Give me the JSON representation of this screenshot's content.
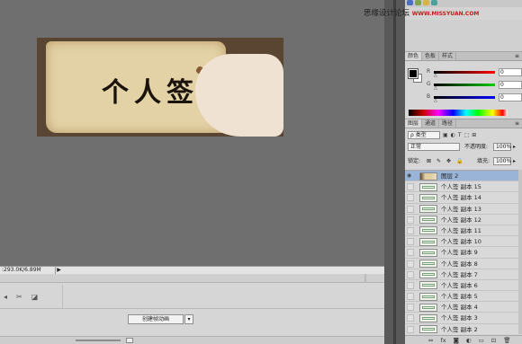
{
  "canvas": {
    "title_art": "个人签"
  },
  "status": {
    "doc_size": ":293.0K/6.89M",
    "arrow": "▶"
  },
  "timeline": {
    "create_button": "创建帧动画",
    "dropdown_arrow": "▾",
    "tools": [
      "◂",
      "✂",
      "◪"
    ]
  },
  "watermark": {
    "cn": "思缘设计论坛",
    "en": "WWW.MISSYUAN.COM"
  },
  "color_panel": {
    "tabs": [
      "颜色",
      "色板",
      "样式"
    ],
    "active_tab": 0,
    "menu": "≡",
    "channels": [
      {
        "label": "R",
        "value": "0",
        "color": "#cc0000"
      },
      {
        "label": "G",
        "value": "0",
        "color": "#009900"
      },
      {
        "label": "B",
        "value": "0",
        "color": "#0000cc"
      }
    ],
    "foreground": "#000000",
    "background": "#ffffff"
  },
  "layers_panel": {
    "tabs": [
      "图层",
      "通道",
      "路径"
    ],
    "active_tab": 0,
    "menu": "≡",
    "filter_select": "ρ 类型",
    "filter_icons": [
      "▣",
      "◐",
      "T",
      "⬚",
      "⊞"
    ],
    "blend_mode": "正常",
    "opacity_label": "不透明度:",
    "opacity_value": "100%",
    "lock_label": "锁定:",
    "lock_icons": [
      "⊠",
      "✎",
      "✥",
      "🔒"
    ],
    "fill_label": "填充:",
    "fill_value": "100%",
    "layers": [
      {
        "name": "图层 2",
        "visible": true,
        "selected": true,
        "photo": true
      },
      {
        "name": "个人签 副本 15",
        "visible": false
      },
      {
        "name": "个人签 副本 14",
        "visible": false
      },
      {
        "name": "个人签 副本 13",
        "visible": false
      },
      {
        "name": "个人签 副本 12",
        "visible": false
      },
      {
        "name": "个人签 副本 11",
        "visible": false
      },
      {
        "name": "个人签 副本 10",
        "visible": false
      },
      {
        "name": "个人签 副本 9",
        "visible": false
      },
      {
        "name": "个人签 副本 8",
        "visible": false
      },
      {
        "name": "个人签 副本 7",
        "visible": false
      },
      {
        "name": "个人签 副本 6",
        "visible": false
      },
      {
        "name": "个人签 副本 5",
        "visible": false
      },
      {
        "name": "个人签 副本 4",
        "visible": false
      },
      {
        "name": "个人签 副本 3",
        "visible": false
      },
      {
        "name": "个人签 副本 2",
        "visible": false
      }
    ],
    "footer_icons": [
      "⇔",
      "fx",
      "◙",
      "◐",
      "▭",
      "⊡",
      "🗑"
    ]
  }
}
